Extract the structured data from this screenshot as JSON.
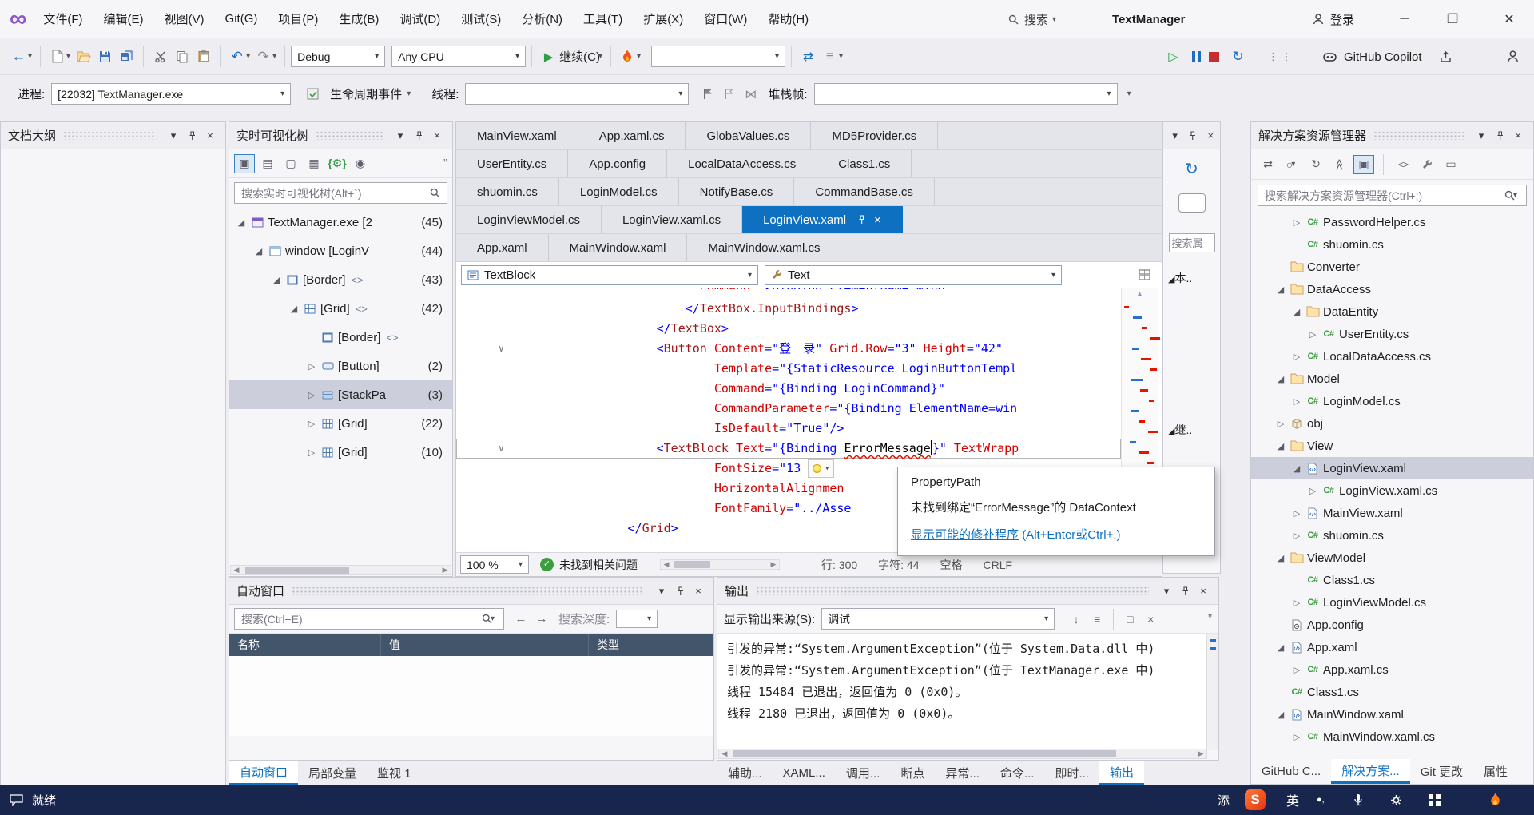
{
  "colors": {
    "accent": "#0e70c1",
    "active_tab": "#0e70c1",
    "status_bar": "#18264e",
    "selection": "#cccedb",
    "error_red": "#e51400",
    "xaml_element": "#a31515",
    "xaml_attribute": "#d40000",
    "xaml_value": "#0000ff",
    "folder_yellow": "#ffe3a9",
    "flame_orange": "#f25022"
  },
  "title_bar": {
    "menus": [
      "文件(F)",
      "编辑(E)",
      "视图(V)",
      "Git(G)",
      "项目(P)",
      "生成(B)",
      "调试(D)",
      "测试(S)",
      "分析(N)",
      "工具(T)",
      "扩展(X)",
      "窗口(W)",
      "帮助(H)"
    ],
    "search_label": "搜索",
    "window_title": "TextManager",
    "sign_in_label": "登录"
  },
  "toolbar": {
    "debug_config": "Debug",
    "platform": "Any CPU",
    "continue_label": "继续(C)",
    "copilot_label": "GitHub Copilot"
  },
  "debug_bar": {
    "process_label": "进程:",
    "process_value": "[22032] TextManager.exe",
    "lifecycle_label": "生命周期事件",
    "thread_label": "线程:",
    "stack_label": "堆栈帧:"
  },
  "document_outline": {
    "title": "文档大纲"
  },
  "live_visual_tree": {
    "title": "实时可视化树",
    "search_placeholder": "搜索实时可视化树(Alt+`)",
    "items": [
      {
        "level": 0,
        "expanded": true,
        "icon": "app",
        "label": "TextManager.exe [2",
        "count": "(45)"
      },
      {
        "level": 1,
        "expanded": true,
        "icon": "window",
        "label": "window [LoginV",
        "count": "(44)"
      },
      {
        "level": 2,
        "expanded": true,
        "icon": "border",
        "label": "[Border]",
        "badge": "<>",
        "count": "(43)"
      },
      {
        "level": 3,
        "expanded": true,
        "icon": "grid",
        "label": "[Grid]",
        "badge": "<>",
        "count": "(42)"
      },
      {
        "level": 4,
        "expanded": null,
        "icon": "border",
        "label": "[Border]",
        "badge": "<>",
        "count": ""
      },
      {
        "level": 4,
        "expanded": false,
        "icon": "button",
        "label": "[Button]",
        "count": "(2)"
      },
      {
        "level": 4,
        "expanded": false,
        "icon": "stack",
        "label": "[StackPa",
        "count": "(3)",
        "selected": true
      },
      {
        "level": 4,
        "expanded": false,
        "icon": "grid",
        "label": "[Grid]",
        "count": "(22)"
      },
      {
        "level": 4,
        "expanded": false,
        "icon": "grid",
        "label": "[Grid]",
        "count": "(10)"
      }
    ]
  },
  "editor": {
    "tab_rows": [
      [
        "MainView.xaml",
        "App.xaml.cs",
        "GlobaValues.cs",
        "MD5Provider.cs"
      ],
      [
        "UserEntity.cs",
        "App.config",
        "LocalDataAccess.cs",
        "Class1.cs"
      ],
      [
        "shuomin.cs",
        "LoginModel.cs",
        "NotifyBase.cs",
        "CommandBase.cs"
      ],
      [
        "LoginViewModel.cs",
        "LoginView.xaml.cs",
        "LoginView.xaml"
      ],
      [
        "App.xaml",
        "MainWindow.xaml",
        "MainWindow.xaml.cs"
      ]
    ],
    "active_tab": "LoginView.xaml",
    "element_combo": "TextBlock",
    "property_combo": "Text",
    "code_lines": [
      {
        "partial": true,
        "tokens": [
          [
            "pl",
            "                          "
          ],
          [
            "at",
            "Command"
          ],
          [
            "st",
            "=\"{Binding ElementName=Wind"
          ]
        ]
      },
      {
        "tokens": [
          [
            "st",
            "                        </"
          ],
          [
            "el",
            "TextBox.InputBindings"
          ],
          [
            "st",
            ">"
          ]
        ]
      },
      {
        "tokens": [
          [
            "st",
            "                    </"
          ],
          [
            "el",
            "TextBox"
          ],
          [
            "st",
            ">"
          ]
        ]
      },
      {
        "collapse": true,
        "tokens": [
          [
            "st",
            "                    <"
          ],
          [
            "el",
            "Button"
          ],
          [
            "pl",
            " "
          ],
          [
            "at",
            "Content"
          ],
          [
            "st",
            "=\"登　录\" "
          ],
          [
            "at",
            "Grid.Row"
          ],
          [
            "st",
            "=\"3\" "
          ],
          [
            "at",
            "Height"
          ],
          [
            "st",
            "=\"42\""
          ]
        ]
      },
      {
        "tokens": [
          [
            "pl",
            "                            "
          ],
          [
            "at",
            "Template"
          ],
          [
            "st",
            "=\"{StaticResource LoginButtonTempl"
          ]
        ]
      },
      {
        "tokens": [
          [
            "pl",
            "                            "
          ],
          [
            "at",
            "Command"
          ],
          [
            "st",
            "=\"{Binding LoginCommand}\""
          ]
        ]
      },
      {
        "tokens": [
          [
            "pl",
            "                            "
          ],
          [
            "at",
            "CommandParameter"
          ],
          [
            "st",
            "=\"{Binding ElementName=win"
          ]
        ]
      },
      {
        "tokens": [
          [
            "pl",
            "                            "
          ],
          [
            "at",
            "IsDefault"
          ],
          [
            "st",
            "=\"True\"/>"
          ]
        ]
      },
      {
        "current": true,
        "collapse": true,
        "tokens": [
          [
            "st",
            "                    <"
          ],
          [
            "el",
            "TextBlock"
          ],
          [
            "pl",
            " "
          ],
          [
            "at",
            "Text"
          ],
          [
            "st",
            "=\"{Binding "
          ],
          [
            "err",
            "ErrorMessage"
          ],
          [
            "caret",
            ""
          ],
          [
            "st",
            "}\" "
          ],
          [
            "at",
            "TextWrapp"
          ]
        ]
      },
      {
        "tokens": [
          [
            "pl",
            "                            "
          ],
          [
            "at",
            "FontSize"
          ],
          [
            "st",
            "=\"13"
          ],
          [
            "bulb",
            ""
          ]
        ]
      },
      {
        "tokens": [
          [
            "pl",
            "                            "
          ],
          [
            "at",
            "HorizontalAlignmen"
          ]
        ]
      },
      {
        "tokens": [
          [
            "pl",
            "                            "
          ],
          [
            "at",
            "FontFamily"
          ],
          [
            "st",
            "=\"../Asse"
          ]
        ]
      },
      {
        "tokens": [
          [
            "st",
            "                </"
          ],
          [
            "el",
            "Grid"
          ],
          [
            "st",
            ">"
          ]
        ]
      }
    ],
    "zoom": "100 %",
    "issues_status": "未找到相关问题",
    "line_info": [
      "行: 300",
      "字符: 44",
      "空格",
      "CRLF"
    ]
  },
  "quick_fix": {
    "title": "PropertyPath",
    "message": "未找到绑定“ErrorMessage”的 DataContext",
    "action": "显示可能的修补程序",
    "shortcut": "(Alt+Enter或Ctrl+.)"
  },
  "autos": {
    "title": "自动窗口",
    "search_placeholder": "搜索(Ctrl+E)",
    "depth_label": "搜索深度:",
    "columns": [
      "名称",
      "值",
      "类型"
    ],
    "tabs": [
      "自动窗口",
      "局部变量",
      "监视 1"
    ],
    "active_tab_index": 0
  },
  "output": {
    "title": "输出",
    "source_label": "显示输出来源(S):",
    "source_value": "调试",
    "lines": [
      "引发的异常:“System.ArgumentException”(位于 System.Data.dll 中)",
      "引发的异常:“System.ArgumentException”(位于 TextManager.exe 中)",
      "线程 15484 已退出，返回值为 0 (0x0)。",
      "线程 2180 已退出，返回值为 0 (0x0)。"
    ],
    "tabs": [
      "辅助...",
      "XAML...",
      "调用...",
      "断点",
      "异常...",
      "命令...",
      "即时...",
      "输出"
    ],
    "active_tab_index": 7
  },
  "solution_explorer": {
    "title": "解决方案资源管理器",
    "search_placeholder": "搜索解决方案资源管理器(Ctrl+;)",
    "items": [
      {
        "level": 2,
        "arrow": "right",
        "icon": "cs",
        "label": "PasswordHelper.cs"
      },
      {
        "level": 2,
        "arrow": "none",
        "icon": "cs",
        "label": "shuomin.cs"
      },
      {
        "level": 1,
        "arrow": "none",
        "icon": "folder",
        "label": "Converter"
      },
      {
        "level": 1,
        "arrow": "down",
        "icon": "folder",
        "label": "DataAccess"
      },
      {
        "level": 2,
        "arrow": "down",
        "icon": "folder",
        "label": "DataEntity"
      },
      {
        "level": 3,
        "arrow": "right",
        "icon": "cs",
        "label": "UserEntity.cs"
      },
      {
        "level": 2,
        "arrow": "right",
        "icon": "cs",
        "label": "LocalDataAccess.cs"
      },
      {
        "level": 1,
        "arrow": "down",
        "icon": "folder",
        "label": "Model"
      },
      {
        "level": 2,
        "arrow": "right",
        "icon": "cs",
        "label": "LoginModel.cs"
      },
      {
        "level": 1,
        "arrow": "right",
        "icon": "obj",
        "label": "obj"
      },
      {
        "level": 1,
        "arrow": "down",
        "icon": "folder",
        "label": "View"
      },
      {
        "level": 2,
        "arrow": "down",
        "icon": "xaml",
        "label": "LoginView.xaml",
        "selected": true
      },
      {
        "level": 3,
        "arrow": "right",
        "icon": "cs",
        "label": "LoginView.xaml.cs"
      },
      {
        "level": 2,
        "arrow": "right",
        "icon": "xaml",
        "label": "MainView.xaml"
      },
      {
        "level": 2,
        "arrow": "right",
        "icon": "cs",
        "label": "shuomin.cs"
      },
      {
        "level": 1,
        "arrow": "down",
        "icon": "folder",
        "label": "ViewModel"
      },
      {
        "level": 2,
        "arrow": "none",
        "icon": "cs",
        "label": "Class1.cs"
      },
      {
        "level": 2,
        "arrow": "right",
        "icon": "cs",
        "label": "LoginViewModel.cs"
      },
      {
        "level": 1,
        "arrow": "none",
        "icon": "config",
        "label": "App.config"
      },
      {
        "level": 1,
        "arrow": "down",
        "icon": "xaml",
        "label": "App.xaml"
      },
      {
        "level": 2,
        "arrow": "right",
        "icon": "cs",
        "label": "App.xaml.cs"
      },
      {
        "level": 1,
        "arrow": "none",
        "icon": "cs",
        "label": "Class1.cs"
      },
      {
        "level": 1,
        "arrow": "down",
        "icon": "xaml",
        "label": "MainWindow.xaml"
      },
      {
        "level": 2,
        "arrow": "right",
        "icon": "cs",
        "label": "MainWindow.xaml.cs"
      }
    ],
    "tabs": [
      "GitHub C...",
      "解决方案...",
      "Git 更改",
      "属性"
    ],
    "active_tab_index": 1
  },
  "properties_strip": {
    "search_text": "搜索属",
    "category1": "本..",
    "category2": "继.."
  },
  "status_bar": {
    "ready": "就绪",
    "fragment": "添",
    "ime": "英",
    "ime_punct": "●,",
    "sogou": "S"
  }
}
